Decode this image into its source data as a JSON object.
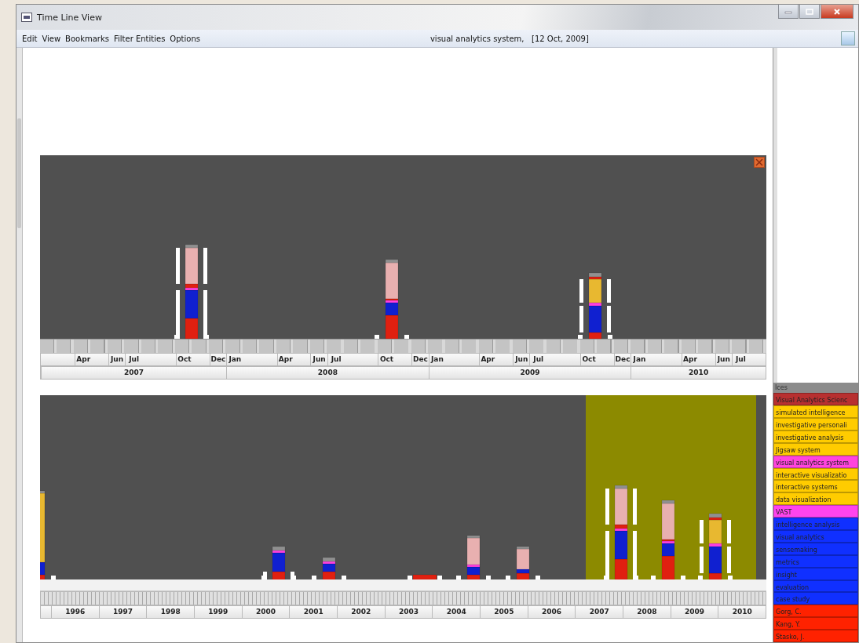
{
  "window": {
    "title": "Time Line View"
  },
  "menu": [
    "Edit",
    "View",
    "Bookmarks",
    "Filter Entities",
    "Options"
  ],
  "status": "visual analytics system,   [12 Oct, 2009]",
  "top_timeline": {
    "months": [
      "Apr",
      "Jun",
      "Jul",
      "Oct",
      "Dec",
      "Jan",
      "Apr",
      "Jun",
      "Jul",
      "Oct",
      "Dec",
      "Jan",
      "Apr",
      "Jun",
      "Jul",
      "Oct",
      "Dec",
      "Jan",
      "Apr",
      "Jun",
      "Jul"
    ],
    "years": [
      "2007",
      "2008",
      "2009",
      "2010"
    ]
  },
  "bottom_timeline": {
    "years": [
      "1996",
      "1997",
      "1998",
      "1999",
      "2000",
      "2001",
      "2002",
      "2003",
      "2004",
      "2005",
      "2006",
      "2007",
      "2008",
      "2009",
      "2010"
    ]
  },
  "legend": {
    "header": "Ices",
    "items": [
      {
        "label": "Visual Analytics Scienc",
        "color": "#b83030"
      },
      {
        "label": "simulated intelligence",
        "color": "#ffcc00"
      },
      {
        "label": "investigative personali",
        "color": "#ffcc00"
      },
      {
        "label": "investigative analysis",
        "color": "#ffcc00"
      },
      {
        "label": "Jigsaw system",
        "color": "#ffcc00"
      },
      {
        "label": "visual analytics system",
        "color": "#ff44dd"
      },
      {
        "label": "interactive visualizatio",
        "color": "#ffcc00"
      },
      {
        "label": "interactive systems",
        "color": "#ffcc00"
      },
      {
        "label": "data visualization",
        "color": "#ffcc00"
      },
      {
        "label": "VAST",
        "color": "#ff44ee"
      },
      {
        "label": "intelligence analysis",
        "color": "#1030ff"
      },
      {
        "label": "visual analytics",
        "color": "#1030ff"
      },
      {
        "label": "sensemaking",
        "color": "#1030ff"
      },
      {
        "label": "metrics",
        "color": "#1030ff"
      },
      {
        "label": "insight",
        "color": "#1030ff"
      },
      {
        "label": "evaluation",
        "color": "#1030ff"
      },
      {
        "label": "case study",
        "color": "#1030ff"
      },
      {
        "label": "Gorg, C.",
        "color": "#ff2200"
      },
      {
        "label": "Kang, Y.",
        "color": "#ff2200"
      },
      {
        "label": "Stasko, J.",
        "color": "#ff2200"
      }
    ]
  }
}
